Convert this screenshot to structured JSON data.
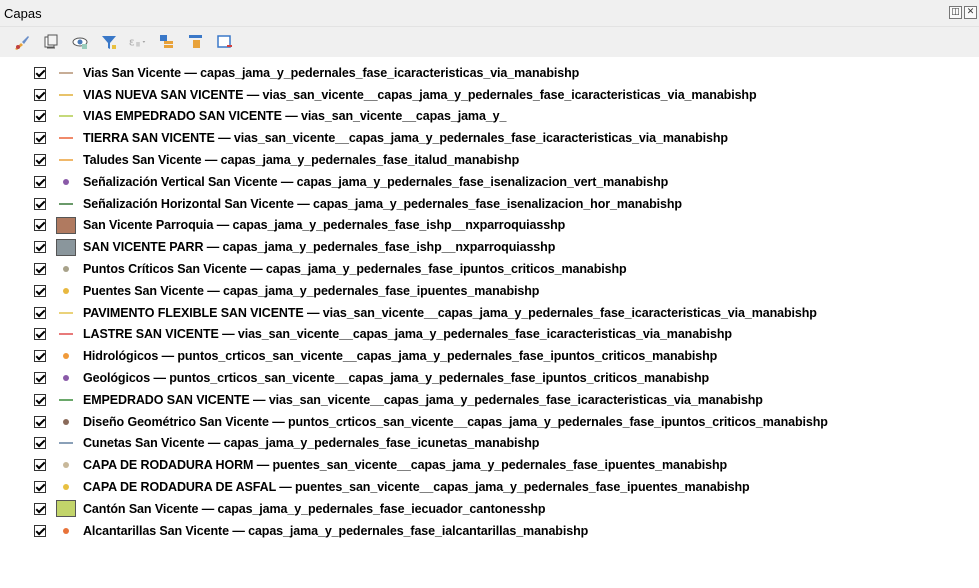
{
  "panel": {
    "title": "Capas",
    "float_glyph": "◫",
    "close_glyph": "✕"
  },
  "toolbar": {
    "tools": [
      {
        "name": "style-brush-icon"
      },
      {
        "name": "add-group-icon"
      },
      {
        "name": "visibility-eye-icon"
      },
      {
        "name": "filter-legend-icon"
      },
      {
        "name": "filter-expression-icon"
      },
      {
        "name": "expand-all-icon"
      },
      {
        "name": "collapse-all-icon"
      },
      {
        "name": "remove-layer-icon"
      }
    ]
  },
  "layers": [
    {
      "label": "Vias San Vicente — capas_jama_y_pedernales_fase_icaracteristicas_via_manabishp",
      "symbol": "line",
      "color": "#c7ad96",
      "checked": true
    },
    {
      "label": "VIAS NUEVA SAN VICENTE — vias_san_vicente__capas_jama_y_pedernales_fase_icaracteristicas_via_manabishp",
      "symbol": "line",
      "color": "#e8c36a",
      "checked": true
    },
    {
      "label": "VIAS EMPEDRADO SAN VICENTE — vias_san_vicente__capas_jama_y_",
      "symbol": "line",
      "color": "#c5d97a",
      "checked": true
    },
    {
      "label": "TIERRA SAN VICENTE — vias_san_vicente__capas_jama_y_pedernales_fase_icaracteristicas_via_manabishp",
      "symbol": "line",
      "color": "#f08a6a",
      "checked": true
    },
    {
      "label": "Taludes San Vicente — capas_jama_y_pedernales_fase_italud_manabishp",
      "symbol": "line",
      "color": "#f0b86a",
      "checked": true
    },
    {
      "label": "Señalización Vertical San Vicente — capas_jama_y_pedernales_fase_isenalizacion_vert_manabishp",
      "symbol": "dot",
      "color": "#8a5aa8",
      "checked": true
    },
    {
      "label": "Señalización Horizontal San Vicente — capas_jama_y_pedernales_fase_isenalizacion_hor_manabishp",
      "symbol": "line",
      "color": "#6a9a6a",
      "checked": true
    },
    {
      "label": "San Vicente Parroquia — capas_jama_y_pedernales_fase_ishp__nxparroquiasshp",
      "symbol": "fill",
      "color": "#b07a60",
      "checked": true
    },
    {
      "label": "SAN VICENTE PARR — capas_jama_y_pedernales_fase_ishp__nxparroquiasshp",
      "symbol": "fill",
      "color": "#8a969c",
      "checked": true
    },
    {
      "label": "Puntos Críticos San Vicente — capas_jama_y_pedernales_fase_ipuntos_criticos_manabishp",
      "symbol": "dot",
      "color": "#a8a28a",
      "checked": true
    },
    {
      "label": "Puentes San Vicente — capas_jama_y_pedernales_fase_ipuentes_manabishp",
      "symbol": "dot",
      "color": "#e8b840",
      "checked": true
    },
    {
      "label": "PAVIMENTO FLEXIBLE SAN VICENTE — vias_san_vicente__capas_jama_y_pedernales_fase_icaracteristicas_via_manabishp",
      "symbol": "line",
      "color": "#ead27a",
      "checked": true
    },
    {
      "label": "LASTRE SAN VICENTE — vias_san_vicente__capas_jama_y_pedernales_fase_icaracteristicas_via_manabishp",
      "symbol": "line",
      "color": "#e87a7a",
      "checked": true
    },
    {
      "label": "Hidrológicos — puntos_crticos_san_vicente__capas_jama_y_pedernales_fase_ipuntos_criticos_manabishp",
      "symbol": "dot",
      "color": "#f09a3a",
      "checked": true
    },
    {
      "label": "Geológicos — puntos_crticos_san_vicente__capas_jama_y_pedernales_fase_ipuntos_criticos_manabishp",
      "symbol": "dot",
      "color": "#8a5aa8",
      "checked": true
    },
    {
      "label": "EMPEDRADO SAN VICENTE — vias_san_vicente__capas_jama_y_pedernales_fase_icaracteristicas_via_manabishp",
      "symbol": "line",
      "color": "#6aa86a",
      "checked": true
    },
    {
      "label": "Diseño Geométrico San Vicente — puntos_crticos_san_vicente__capas_jama_y_pedernales_fase_ipuntos_criticos_manabishp",
      "symbol": "dot",
      "color": "#8a6a5a",
      "checked": true
    },
    {
      "label": "Cunetas San Vicente — capas_jama_y_pedernales_fase_icunetas_manabishp",
      "symbol": "line",
      "color": "#8aa0b8",
      "checked": true
    },
    {
      "label": "CAPA DE RODADURA HORM — puentes_san_vicente__capas_jama_y_pedernales_fase_ipuentes_manabishp",
      "symbol": "dot",
      "color": "#c8b89a",
      "checked": true
    },
    {
      "label": "CAPA DE RODADURA DE ASFAL — puentes_san_vicente__capas_jama_y_pedernales_fase_ipuentes_manabishp",
      "symbol": "dot",
      "color": "#e8c040",
      "checked": true
    },
    {
      "label": "Cantón San Vicente — capas_jama_y_pedernales_fase_iecuador_cantonesshp",
      "symbol": "fill",
      "color": "#c2d46a",
      "checked": true
    },
    {
      "label": "Alcantarillas San Vicente — capas_jama_y_pedernales_fase_ialcantarillas_manabishp",
      "symbol": "dot",
      "color": "#e8733a",
      "checked": true
    }
  ]
}
